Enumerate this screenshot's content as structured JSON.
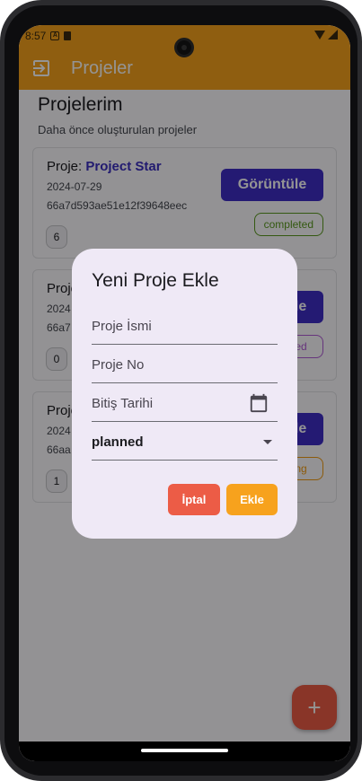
{
  "status_bar": {
    "time": "8:57"
  },
  "app_bar": {
    "title": "Projeler",
    "icon": "logout-icon"
  },
  "page": {
    "title": "Projelerim",
    "subtitle": "Daha önce oluşturulan projeler"
  },
  "cards": [
    {
      "prefix": "Proje:",
      "name": "Project Star",
      "date": "2024-07-29",
      "id": "66a7d593ae51e12f39648eec",
      "count": "6",
      "button": "Görüntüle",
      "status": "completed",
      "status_color": "#5a9a1e"
    },
    {
      "prefix": "Proje:",
      "name": "",
      "date": "2024",
      "id": "66a7",
      "count": "0",
      "button": "Görüntüle",
      "status": "ed",
      "status_color": "#b05ad6"
    },
    {
      "prefix": "Proje:",
      "name": "",
      "date": "2024",
      "id": "66aa",
      "count": "1",
      "button": "Görüntüle",
      "status": "ng",
      "status_color": "#f29c12"
    }
  ],
  "dialog": {
    "title": "Yeni Proje Ekle",
    "name_label": "Proje İsmi",
    "no_label": "Proje No",
    "date_label": "Bitiş Tarihi",
    "status_value": "planned",
    "cancel_label": "İptal",
    "add_label": "Ekle"
  },
  "fab": {
    "label": "+"
  },
  "colors": {
    "accent": "#f7a21d",
    "primary": "#3e2dc6",
    "danger": "#ec5c46"
  }
}
